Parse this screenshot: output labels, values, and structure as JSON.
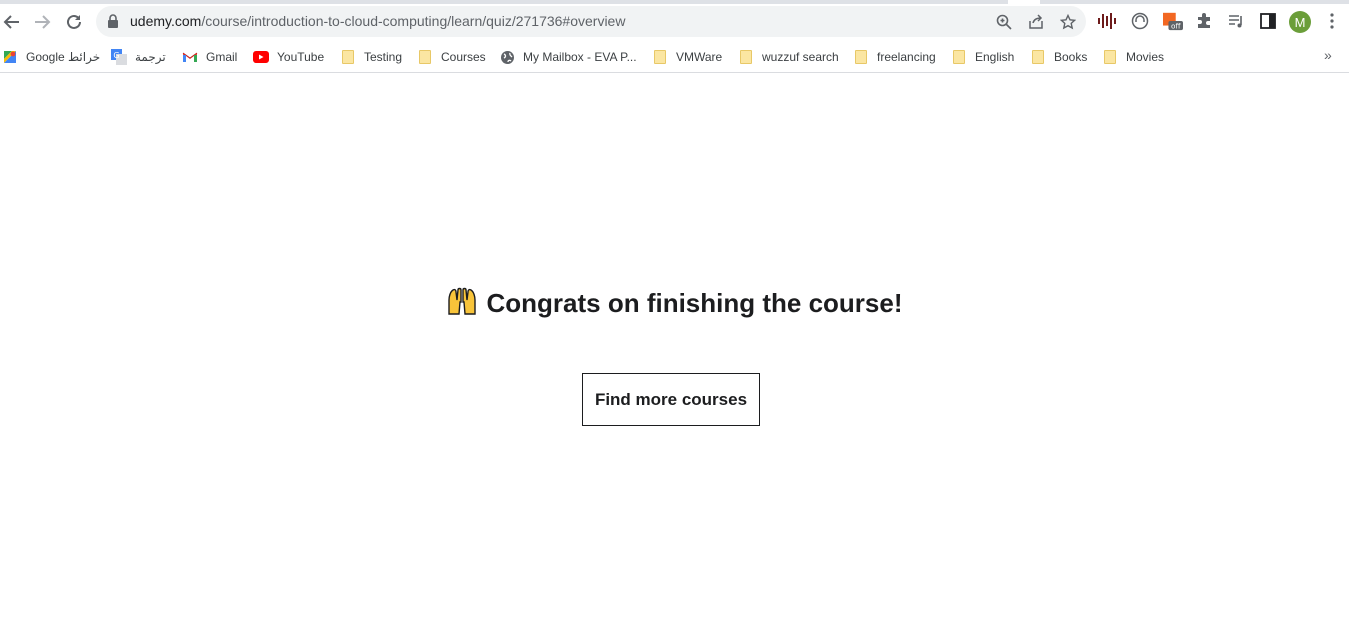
{
  "browser": {
    "url_host": "udemy.com",
    "url_path": "/course/introduction-to-cloud-computing/learn/quiz/271736#overview",
    "profile_initial": "M",
    "extension_badge": "off"
  },
  "bookmarks": {
    "items": [
      {
        "label": "Google خرائط",
        "icon": "google-maps-icon"
      },
      {
        "label": "ترجمة",
        "icon": "google-translate-icon"
      },
      {
        "label": "Gmail",
        "icon": "gmail-icon"
      },
      {
        "label": "YouTube",
        "icon": "youtube-icon"
      },
      {
        "label": "Testing",
        "icon": "folder-icon"
      },
      {
        "label": "Courses",
        "icon": "folder-icon"
      },
      {
        "label": "My Mailbox - EVA P...",
        "icon": "globe-icon"
      },
      {
        "label": "VMWare",
        "icon": "folder-icon"
      },
      {
        "label": "wuzzuf search",
        "icon": "folder-icon"
      },
      {
        "label": "freelancing",
        "icon": "folder-icon"
      },
      {
        "label": "English",
        "icon": "folder-icon"
      },
      {
        "label": "Books",
        "icon": "folder-icon"
      },
      {
        "label": "Movies",
        "icon": "folder-icon"
      }
    ],
    "more": "»"
  },
  "main": {
    "congrats_title": "Congrats on finishing the course!",
    "find_courses_button": "Find more courses"
  },
  "colors": {
    "text": "#1c1d1f",
    "avatar": "#6b9e3a",
    "omnibox": "#f1f3f4"
  }
}
